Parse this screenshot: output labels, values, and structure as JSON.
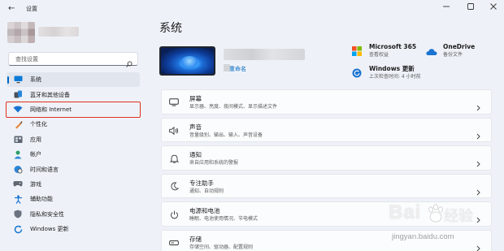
{
  "window": {
    "title": "设置",
    "controls": [
      "minimize",
      "maximize",
      "close"
    ]
  },
  "search": {
    "placeholder": "查找设置"
  },
  "sidebar": {
    "items": [
      {
        "label": "系统",
        "icon": "monitor-icon",
        "active": true
      },
      {
        "label": "蓝牙和其他设备",
        "icon": "bluetooth-icon"
      },
      {
        "label": "网络和 Internet",
        "icon": "wifi-icon",
        "highlighted": true
      },
      {
        "label": "个性化",
        "icon": "brush-icon"
      },
      {
        "label": "应用",
        "icon": "apps-icon"
      },
      {
        "label": "帐户",
        "icon": "person-icon"
      },
      {
        "label": "时间和语言",
        "icon": "globe-clock-icon"
      },
      {
        "label": "游戏",
        "icon": "gamepad-icon"
      },
      {
        "label": "辅助功能",
        "icon": "accessibility-icon"
      },
      {
        "label": "隐私和安全性",
        "icon": "shield-icon"
      },
      {
        "label": "Windows 更新",
        "icon": "update-icon"
      }
    ]
  },
  "main": {
    "title": "系统",
    "device": {
      "rename_label": "重命名"
    },
    "quick_links": {
      "ms365": {
        "title": "Microsoft 365",
        "subtitle": "查看权益"
      },
      "onedrive": {
        "title": "OneDrive",
        "subtitle": "备份文件"
      },
      "winupdate": {
        "title": "Windows 更新",
        "subtitle": "上次检查时间: 4 小时前"
      }
    },
    "cards": [
      {
        "title": "屏幕",
        "subtitle": "显示器、亮度、夜间模式、显示描述文件",
        "icon": "display-icon"
      },
      {
        "title": "声音",
        "subtitle": "音量级别、输出、输入、声音设备",
        "icon": "speaker-icon"
      },
      {
        "title": "通知",
        "subtitle": "来自应用和系统的警报",
        "icon": "bell-icon"
      },
      {
        "title": "专注助手",
        "subtitle": "通知、自动规则",
        "icon": "moon-icon"
      },
      {
        "title": "电源和电池",
        "subtitle": "睡眠、电池使用情况、节电模式",
        "icon": "power-icon"
      },
      {
        "title": "存储",
        "subtitle": "存储空间、驱动器、配置规则",
        "icon": "storage-icon"
      }
    ]
  },
  "watermark": {
    "brand": "Bai",
    "brand_cn": "经验",
    "url": "jingyan.baidu.com"
  },
  "colors": {
    "accent": "#0067c0",
    "highlight_box": "#e0301e",
    "background": "#eef2f8",
    "card": "#fbfcfd"
  }
}
